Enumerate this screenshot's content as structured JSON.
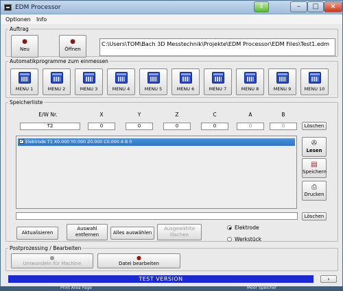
{
  "window": {
    "title": "EDM Processor",
    "update_icon": "update-arrow-icon"
  },
  "menubar": {
    "items": [
      "Optionen",
      "Info"
    ]
  },
  "auftrag": {
    "legend": "Auftrag",
    "neu_label": "Neu",
    "oeffnen_label": "Öffnen",
    "path": "C:\\Users\\TOM\\Bach 3D Messtechnik\\Projekte\\EDM Processor\\EDM Files\\Test1.edm"
  },
  "auto": {
    "legend": "Automatikprogramme zum einmessen",
    "menus": [
      "MENU 1",
      "MENU 2",
      "MENU 3",
      "MENU 4",
      "MENU 5",
      "MENU 6",
      "MENU 7",
      "MENU 8",
      "MENU 9",
      "MENU 10"
    ]
  },
  "speicher": {
    "legend": "Speicherliste",
    "headers": [
      "E/W Nr.",
      "X",
      "Y",
      "Z",
      "C",
      "A",
      "B"
    ],
    "inputs": {
      "ew": "T2",
      "x": "0",
      "y": "0",
      "z": "0",
      "c": "0",
      "a": "0",
      "b": "0"
    },
    "loeschen_top": "Löschen",
    "list_item": "Elektrode  T1         X0.000  Y0.000  Z0.000  C0.000  A  B   0",
    "lesen": "Lesen",
    "speichern": "Speichern",
    "drucken": "Drucken",
    "loeschen_bottom": "Löschen",
    "aktualisieren": "Aktualisieren",
    "auswahl_entfernen_1": "Auswahl",
    "auswahl_entfernen_2": "entfernen",
    "alles_auswaehlen": "Alles auswählen",
    "ausgewaehlte_loeschen_1": "Ausgewählte",
    "ausgewaehlte_loeschen_2": "löschen",
    "radio_elektrode": "Elektrode",
    "radio_werkstueck": "Werkstück"
  },
  "post": {
    "legend": "Postprozessing / Bearbeiten",
    "umwandeln": "Umwandeln für Machine",
    "datei_bearbeiten": "Datei bearbeiten"
  },
  "status": {
    "text": "TEST VERSION",
    "nav": "›"
  },
  "taskbar": {
    "left": "Print Area Page",
    "right": "Moor Speicher"
  }
}
